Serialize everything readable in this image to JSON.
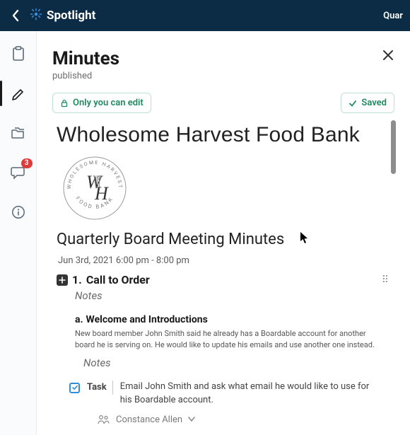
{
  "topbar": {
    "brand": "Spotlight",
    "right_text": "Quar"
  },
  "leftnav": {
    "badge_count": "3"
  },
  "page": {
    "title": "Minutes",
    "status": "published",
    "edit_chip": "Only you can edit",
    "saved_chip": "Saved"
  },
  "doc": {
    "org_name": "Wholesome Harvest Food Bank",
    "logo_top_text": "WHOLESOME HARVEST",
    "logo_monogram_left": "W",
    "logo_monogram_right": "H",
    "logo_bottom_text": "FOOD BANK",
    "meeting_title": "Quarterly Board Meeting Minutes",
    "meeting_date": "Jun 3rd, 2021 6:00 pm - 8:00 pm",
    "agenda": {
      "index": "1.",
      "title": "Call to Order",
      "notes_label": "Notes"
    },
    "subitem": {
      "index": "a.",
      "title": "Welcome and Introductions",
      "body": "New board member John Smith said he already has a Boardable account for another board he is serving on. He would like to update his emails and use another one instead.",
      "notes_label": "Notes"
    },
    "task": {
      "label": "Task",
      "text": "Email John Smith and ask what email he would like to use for his Boardable account.",
      "assignee": "Constance Allen"
    }
  }
}
